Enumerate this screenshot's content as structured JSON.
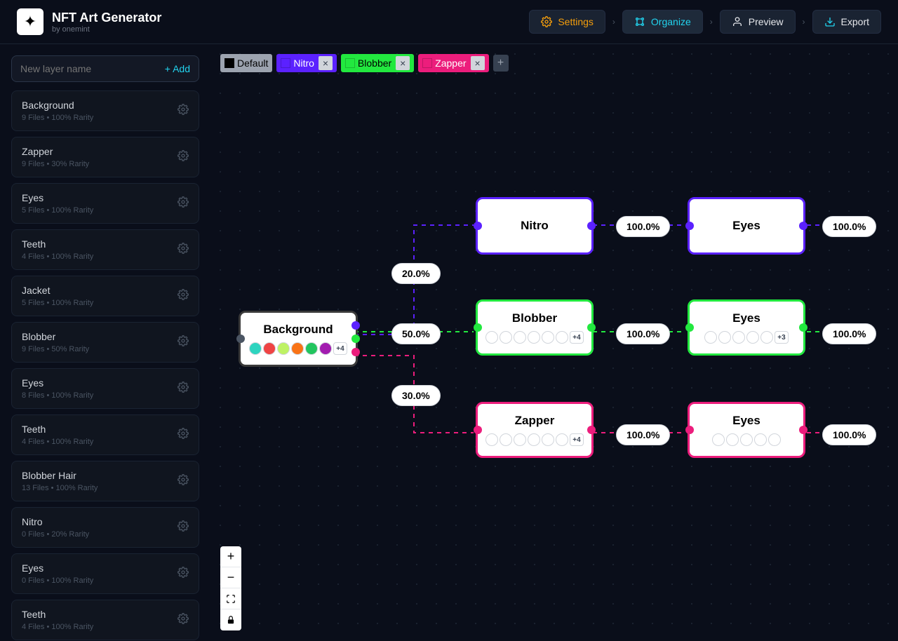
{
  "brand": {
    "title": "NFT Art Generator",
    "subtitle": "by onemint"
  },
  "nav": {
    "settings": "Settings",
    "organize": "Organize",
    "preview": "Preview",
    "export": "Export",
    "sep": "›"
  },
  "sidebar": {
    "placeholder": "New layer name",
    "add_label": "+ Add",
    "layers": [
      {
        "name": "Background",
        "files": "9 Files",
        "rarity": "100% Rarity"
      },
      {
        "name": "Zapper",
        "files": "9 Files",
        "rarity": "30% Rarity"
      },
      {
        "name": "Eyes",
        "files": "5 Files",
        "rarity": "100% Rarity"
      },
      {
        "name": "Teeth",
        "files": "4 Files",
        "rarity": "100% Rarity"
      },
      {
        "name": "Jacket",
        "files": "5 Files",
        "rarity": "100% Rarity"
      },
      {
        "name": "Blobber",
        "files": "9 Files",
        "rarity": "50% Rarity"
      },
      {
        "name": "Eyes",
        "files": "8 Files",
        "rarity": "100% Rarity"
      },
      {
        "name": "Teeth",
        "files": "4 Files",
        "rarity": "100% Rarity"
      },
      {
        "name": "Blobber Hair",
        "files": "13 Files",
        "rarity": "100% Rarity"
      },
      {
        "name": "Nitro",
        "files": "0 Files",
        "rarity": "20% Rarity"
      },
      {
        "name": "Eyes",
        "files": "0 Files",
        "rarity": "100% Rarity"
      },
      {
        "name": "Teeth",
        "files": "4 Files",
        "rarity": "100% Rarity"
      }
    ]
  },
  "tags": [
    {
      "label": "Default",
      "color": "#000000",
      "bg": "#9ca3af",
      "closable": false
    },
    {
      "label": "Nitro",
      "color": "#5b21ff",
      "bg": "#5b21ff",
      "text": "#fff",
      "closable": true
    },
    {
      "label": "Blobber",
      "color": "#22e83f",
      "bg": "#22e83f",
      "closable": true
    },
    {
      "label": "Zapper",
      "color": "#ec1d7c",
      "bg": "#ec1d7c",
      "text": "#fff",
      "closable": true
    }
  ],
  "nodes": {
    "background": {
      "title": "Background",
      "swatches": [
        "#2dd4bf",
        "#ef4444",
        "#bef264",
        "#f97316",
        "#22c55e",
        "#a21caf"
      ],
      "more": "+4"
    },
    "nitro": {
      "title": "Nitro",
      "color": "#5b21ff"
    },
    "blobber": {
      "title": "Blobber",
      "color": "#22e83f",
      "swatches": [
        "#fff",
        "#fff",
        "#fff",
        "#fff",
        "#fff",
        "#fff"
      ],
      "more": "+4"
    },
    "zapper": {
      "title": "Zapper",
      "color": "#ec1d7c",
      "swatches": [
        "#fff",
        "#fff",
        "#fff",
        "#fff",
        "#fff",
        "#fff"
      ],
      "more": "+4"
    },
    "eyes_nitro": {
      "title": "Eyes",
      "color": "#5b21ff"
    },
    "eyes_blobber": {
      "title": "Eyes",
      "color": "#22e83f",
      "swatches": [
        "#fff",
        "#fff",
        "#fff",
        "#fff",
        "#fff"
      ],
      "more": "+3"
    },
    "eyes_zapper": {
      "title": "Eyes",
      "color": "#ec1d7c",
      "swatches": [
        "#fff",
        "#fff",
        "#fff",
        "#fff",
        "#fff"
      ],
      "more": ""
    }
  },
  "edges": {
    "bg_nitro": "20.0%",
    "bg_blobber": "50.0%",
    "bg_zapper": "30.0%",
    "nitro_eyes": "100.0%",
    "blobber_eyes": "100.0%",
    "zapper_eyes": "100.0%",
    "eyes_nitro_out": "100.0%",
    "eyes_blobber_out": "100.0%",
    "eyes_zapper_out": "100.0%"
  }
}
